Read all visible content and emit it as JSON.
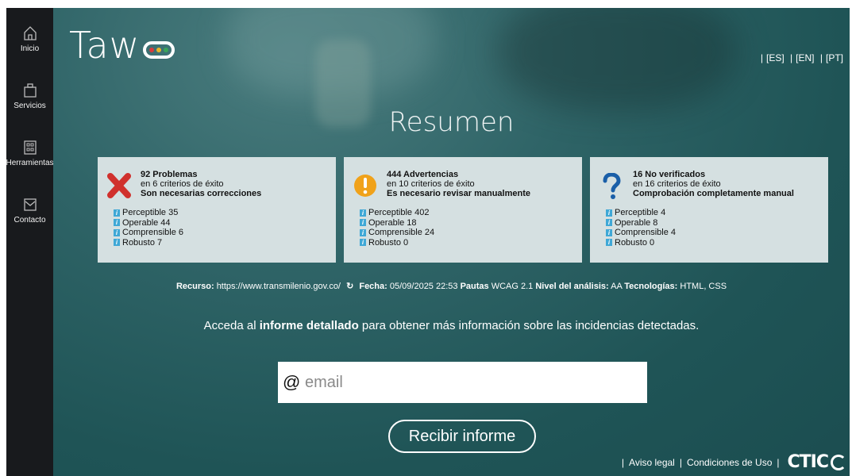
{
  "sidebar": {
    "items": [
      {
        "label": "Inicio",
        "icon": "home-icon"
      },
      {
        "label": "Servicios",
        "icon": "briefcase-icon"
      },
      {
        "label": "Herramientas",
        "icon": "grid-icon"
      },
      {
        "label": "Contacto",
        "icon": "mail-icon"
      }
    ]
  },
  "header": {
    "logo_text": "Taw",
    "languages": [
      "[ES]",
      "[EN]",
      "[PT]"
    ]
  },
  "title": "Resumen",
  "cards": [
    {
      "icon": "error-x-icon",
      "count": "92 Problemas",
      "criteria": "en 6 criterios de éxito",
      "need": "Son necesarias correcciones",
      "items": [
        "Perceptible 35",
        "Operable 44",
        "Comprensible 6",
        "Robusto 7"
      ]
    },
    {
      "icon": "warning-icon",
      "count": "444 Advertencias",
      "criteria": "en 10 criterios de éxito",
      "need": "Es necesario revisar manualmente",
      "items": [
        "Perceptible 402",
        "Operable 18",
        "Comprensible 24",
        "Robusto 0"
      ]
    },
    {
      "icon": "question-icon",
      "count": "16 No verificados",
      "criteria": "en 16 criterios de éxito",
      "need": "Comprobación completamente manual",
      "items": [
        "Perceptible 4",
        "Operable 8",
        "Comprensible 4",
        "Robusto 0"
      ]
    }
  ],
  "meta": {
    "resource_label": "Recurso:",
    "resource_value": "https://www.transmilenio.gov.co/",
    "date_label": "Fecha:",
    "date_value": "05/09/2025 22:53",
    "guidelines_label": "Pautas",
    "guidelines_value": "WCAG 2.1",
    "level_label": "Nivel del análisis:",
    "level_value": "AA",
    "tech_label": "Tecnologías:",
    "tech_value": "HTML, CSS"
  },
  "sentence": {
    "before": "Acceda al ",
    "bold": "informe detallado",
    "after": " para obtener más información sobre las incidencias detectadas."
  },
  "email": {
    "at": "@",
    "placeholder": "email"
  },
  "submit_label": "Recibir informe",
  "footer": {
    "legal": "Aviso legal",
    "terms": "Condiciones de Uso",
    "brand": "CTIC"
  },
  "colors": {
    "sidebar": "#181a1d",
    "main_bg": "#2a5f62",
    "card_bg": "#d5e0e1",
    "error": "#d0312d",
    "warning": "#f0a21a",
    "question": "#1a5fa8",
    "info": "#3fa8d6",
    "logo_dots": [
      "#d93b3b",
      "#e8b62a",
      "#3aa55a"
    ]
  }
}
